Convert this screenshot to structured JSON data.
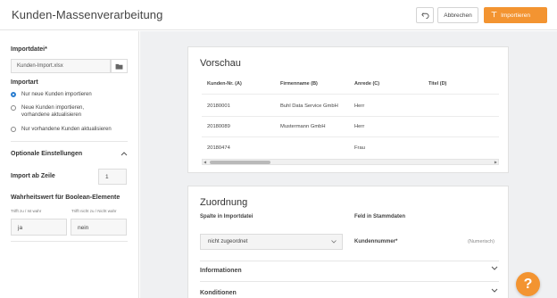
{
  "header": {
    "title": "Kunden-Massenverarbeitung",
    "cancel_label": "Abbrechen",
    "import_label": "Importieren"
  },
  "sidebar": {
    "importfile_label": "Importdatei*",
    "importfile_value": "Kunden-Import.xlsx",
    "importart_label": "Importart",
    "options": [
      {
        "label": "Nur neue Kunden importieren",
        "selected": true
      },
      {
        "label": "Neue Kunden importieren, vorhandene aktualisieren",
        "selected": false
      },
      {
        "label": "Nur vorhandene Kunden aktualisieren",
        "selected": false
      }
    ],
    "optional_label": "Optionale Einstellungen",
    "import_from_row_label": "Import ab Zeile",
    "import_from_row_value": "1",
    "boolean_label": "Wahrheitswert für Boolean-Elemente",
    "true_hint": "Trifft zu / Ist wahr",
    "false_hint": "Trifft nicht zu / Nicht wahr",
    "true_value": "ja",
    "false_value": "nein"
  },
  "preview": {
    "title": "Vorschau",
    "columns": [
      "Kunden-Nr. (A)",
      "Firmenname (B)",
      "Anrede (C)",
      "Titel (D)"
    ],
    "rows": [
      [
        "20180001",
        "Buhl Data Service GmbH",
        "Herr",
        ""
      ],
      [
        "20180089",
        "Mustermann GmbH",
        "Herr",
        ""
      ],
      [
        "20180474",
        "",
        "Frau",
        ""
      ]
    ]
  },
  "mapping": {
    "title": "Zuordnung",
    "col_source": "Spalte in Importdatei",
    "col_target": "Feld in Stammdaten",
    "select_value": "nicht zugeordnet",
    "field_label": "Kundennummer*",
    "field_type": "(Numerisch)",
    "sections": [
      "Informationen",
      "Konditionen"
    ]
  },
  "colors": {
    "accent": "#f39431",
    "radio": "#2a7dcf",
    "background": "#eff0f2"
  }
}
